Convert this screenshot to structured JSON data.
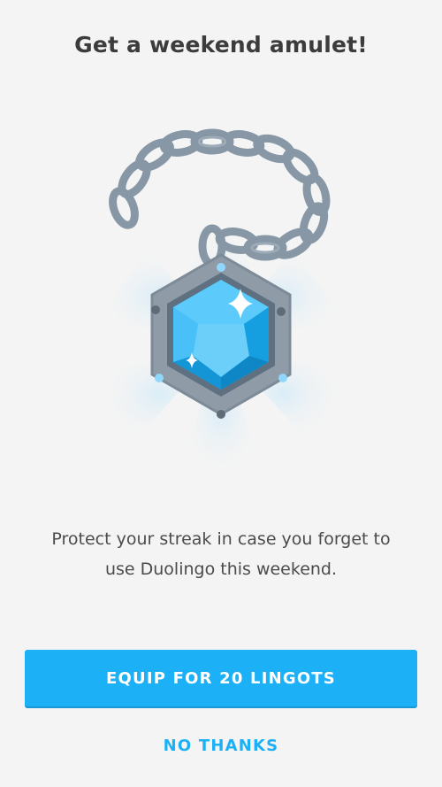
{
  "header": {
    "title": "Get a weekend amulet!"
  },
  "illustration": {
    "icon": "weekend-amulet-icon"
  },
  "body": {
    "line1": "Protect your streak in case you forget to",
    "line2": "use Duolingo this weekend."
  },
  "actions": {
    "equip_label": "EQUIP FOR 20 LINGOTS",
    "decline_label": "NO THANKS"
  },
  "colors": {
    "accent": "#1cb0f6",
    "background": "#f4f4f4",
    "text": "#3c3c3c",
    "chain": "#8a98a6",
    "gem": "#1cb0f6"
  }
}
